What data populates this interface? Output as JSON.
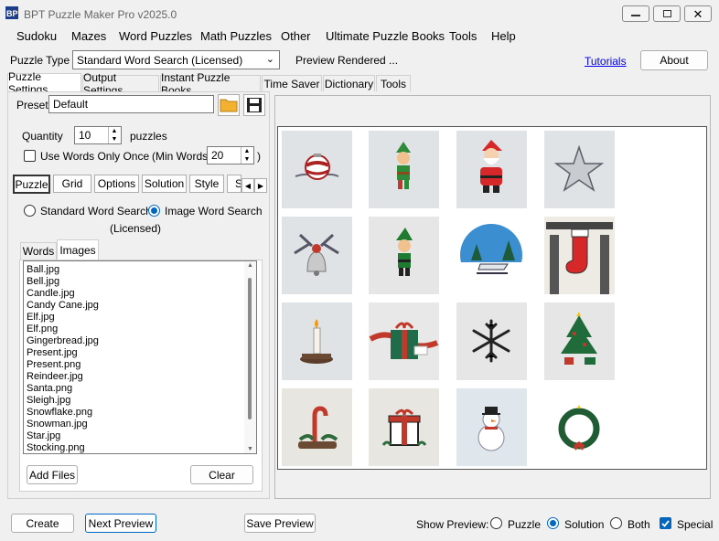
{
  "window": {
    "title": "BPT Puzzle Maker Pro v2025.0"
  },
  "menu": [
    "Sudoku",
    "Mazes",
    "Word Puzzles",
    "Math Puzzles",
    "Other",
    "Ultimate Puzzle Books",
    "Tools",
    "Help"
  ],
  "toolbar": {
    "puzzle_type_label": "Puzzle Type",
    "puzzle_type_value": "Standard Word Search (Licensed)",
    "preview_status": "Preview Rendered ...",
    "tutorials_link": "Tutorials",
    "about_button": "About"
  },
  "tabs": [
    "Puzzle Settings",
    "Output Settings",
    "Instant Puzzle Books",
    "Time Saver",
    "Dictionary",
    "Tools"
  ],
  "settings": {
    "preset_label": "Preset",
    "preset_value": "Default",
    "quantity_label": "Quantity",
    "quantity_value": "10",
    "quantity_unit": "puzzles",
    "use_words_once_label": "Use Words Only Once",
    "min_words_prefix": "(Min Words:",
    "min_words_value": "20",
    "min_words_suffix": ")"
  },
  "subtabs": [
    "Puzzle",
    "Grid",
    "Options",
    "Solution",
    "Style",
    "S"
  ],
  "mode": {
    "standard_label": "Standard Word Search",
    "image_label": "Image Word Search",
    "image_sublabel": "(Licensed)",
    "selected": "image"
  },
  "list_tabs": [
    "Words",
    "Images"
  ],
  "files": [
    "Ball.jpg",
    "Bell.jpg",
    "Candle.jpg",
    "Candy Cane.jpg",
    "Elf.jpg",
    "Elf.png",
    "Gingerbread.jpg",
    "Present.jpg",
    "Present.png",
    "Reindeer.jpg",
    "Santa.png",
    "Sleigh.jpg",
    "Snowflake.png",
    "Snowman.jpg",
    "Star.jpg",
    "Stocking.png"
  ],
  "list_buttons": {
    "add_files": "Add Files",
    "clear": "Clear"
  },
  "footer": {
    "create": "Create",
    "next_preview": "Next Preview",
    "save_preview": "Save Preview",
    "show_preview_label": "Show Preview:",
    "opt_puzzle": "Puzzle",
    "opt_solution": "Solution",
    "opt_both": "Both",
    "special": "Special",
    "selected": "Solution",
    "special_checked": true
  },
  "preview_images": [
    "ornament-ball",
    "elf",
    "santa",
    "star",
    "bell",
    "elf",
    "sleigh",
    "stocking",
    "candle",
    "present",
    "snowflake",
    "christmas-tree",
    "candy-cane",
    "present",
    "snowman",
    "wreath"
  ],
  "colors": {
    "accent": "#0067c0",
    "link": "#0000ee",
    "window_bg": "#f0f0f0"
  }
}
